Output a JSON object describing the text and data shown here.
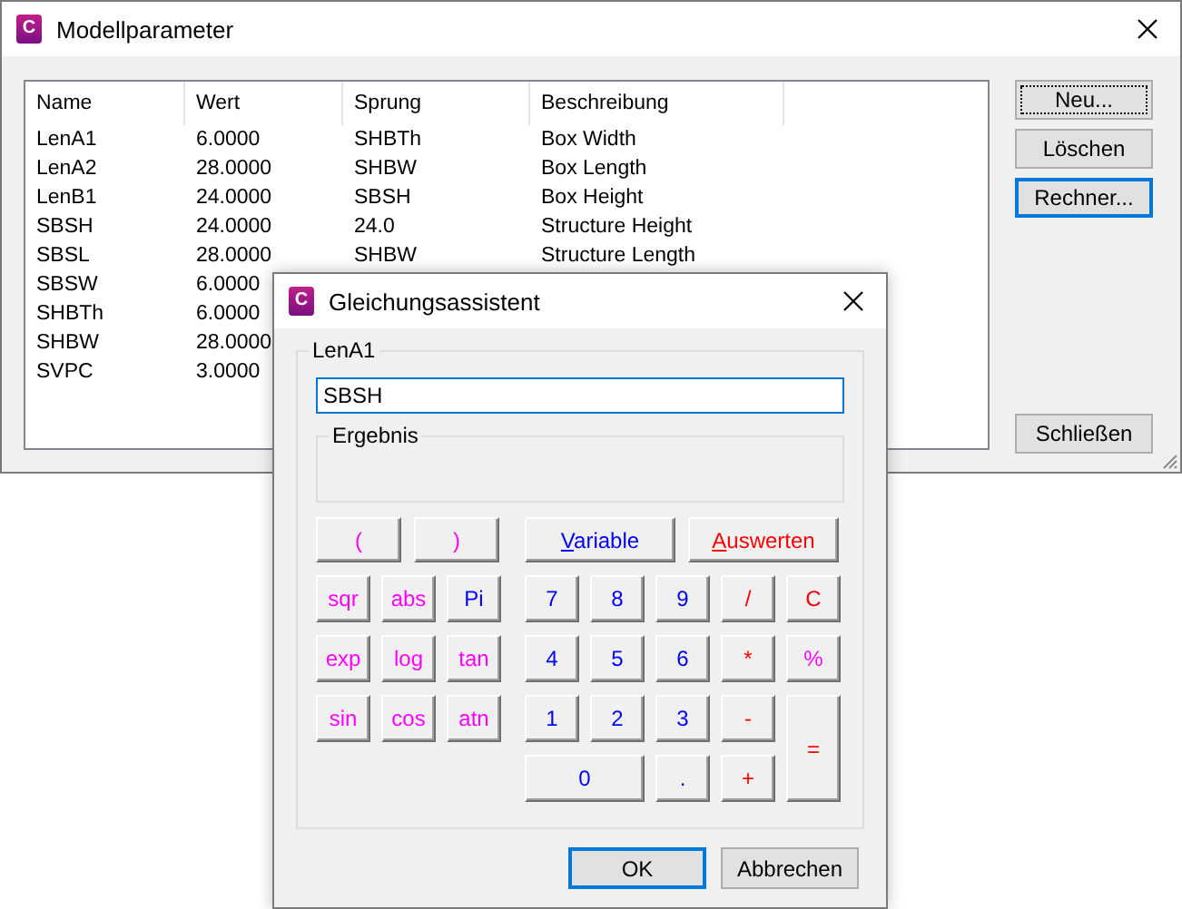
{
  "main_window": {
    "icon_letter": "C",
    "title": "Modellparameter",
    "columns": [
      "Name",
      "Wert",
      "Sprung",
      "Beschreibung"
    ],
    "rows": [
      {
        "cells": [
          "LenA1",
          "6.0000",
          "SHBTh",
          "Box Width"
        ]
      },
      {
        "cells": [
          "LenA2",
          "28.0000",
          "SHBW",
          "Box Length"
        ]
      },
      {
        "cells": [
          "LenB1",
          "24.0000",
          "SBSH",
          "Box Height"
        ]
      },
      {
        "cells": [
          "SBSH",
          "24.0000",
          "24.0",
          "Structure Height"
        ]
      },
      {
        "cells": [
          "SBSL",
          "28.0000",
          "SHBW",
          "Structure Length"
        ]
      },
      {
        "cells": [
          "SBSW",
          "6.0000"
        ]
      },
      {
        "cells": [
          "SHBTh",
          "6.0000"
        ]
      },
      {
        "cells": [
          "SHBW",
          "28.0000"
        ]
      },
      {
        "cells": [
          "SVPC",
          "3.0000"
        ]
      }
    ],
    "buttons": [
      {
        "label": "Neu...",
        "focused": true,
        "default": false
      },
      {
        "label": "Löschen",
        "focused": false,
        "default": false
      },
      {
        "label": "Rechner...",
        "focused": false,
        "default": true
      }
    ],
    "close_button": {
      "label": "Schließen"
    }
  },
  "dialog": {
    "icon_letter": "C",
    "title": "Gleichungsassistent",
    "group_label": "LenA1",
    "expression": {
      "value": "SBSH",
      "focused": true
    },
    "result_label": "Ergebnis",
    "paren_keys": [
      {
        "label": "(",
        "color": "#ff00ff"
      },
      {
        "label": ")",
        "color": "#ff00ff"
      }
    ],
    "action_keys": [
      {
        "label": "Variable",
        "color": "#0000ff",
        "mnemonic": true
      },
      {
        "label": "Auswerten",
        "color": "#ff0000",
        "mnemonic": true
      }
    ],
    "function_keys": [
      {
        "label": "sqr",
        "color": "#ff00ff"
      },
      {
        "label": "abs",
        "color": "#ff00ff"
      },
      {
        "label": "Pi",
        "color": "#0000ff"
      },
      {
        "label": "exp",
        "color": "#ff00ff"
      },
      {
        "label": "log",
        "color": "#ff00ff"
      },
      {
        "label": "tan",
        "color": "#ff00ff"
      },
      {
        "label": "sin",
        "color": "#ff00ff"
      },
      {
        "label": "cos",
        "color": "#ff00ff"
      },
      {
        "label": "atn",
        "color": "#ff00ff"
      }
    ],
    "pad_keys": [
      {
        "label": "7",
        "color": "#0000ff",
        "kind": "normal"
      },
      {
        "label": "8",
        "color": "#0000ff",
        "kind": "normal"
      },
      {
        "label": "9",
        "color": "#0000ff",
        "kind": "normal"
      },
      {
        "label": "/",
        "color": "#ff0000",
        "kind": "normal"
      },
      {
        "label": "C",
        "color": "#ff0000",
        "kind": "normal"
      },
      {
        "label": "4",
        "color": "#0000ff",
        "kind": "normal"
      },
      {
        "label": "5",
        "color": "#0000ff",
        "kind": "normal"
      },
      {
        "label": "6",
        "color": "#0000ff",
        "kind": "normal"
      },
      {
        "label": "*",
        "color": "#ff0000",
        "kind": "normal"
      },
      {
        "label": "%",
        "color": "#ff00ff",
        "kind": "normal"
      },
      {
        "label": "1",
        "color": "#0000ff",
        "kind": "normal"
      },
      {
        "label": "2",
        "color": "#0000ff",
        "kind": "normal"
      },
      {
        "label": "3",
        "color": "#0000ff",
        "kind": "normal"
      },
      {
        "label": "-",
        "color": "#ff0000",
        "kind": "normal"
      },
      {
        "label": "=",
        "color": "#ff0000",
        "kind": "tall"
      },
      {
        "label": "0",
        "color": "#0000ff",
        "kind": "wide"
      },
      {
        "label": ".",
        "color": "#0000ff",
        "kind": "normal"
      },
      {
        "label": "+",
        "color": "#ff0000",
        "kind": "normal"
      }
    ],
    "buttons": [
      {
        "label": "OK",
        "default": true
      },
      {
        "label": "Abbrechen",
        "default": false
      }
    ]
  }
}
